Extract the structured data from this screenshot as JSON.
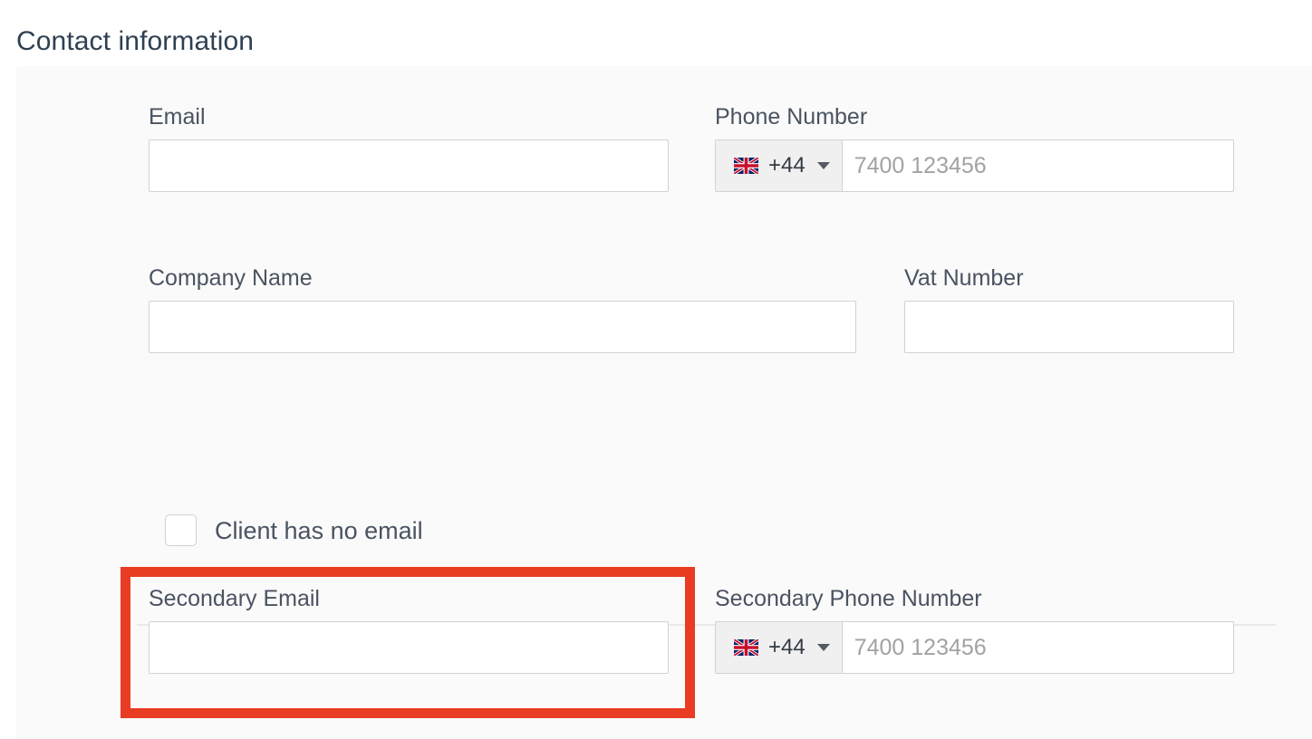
{
  "page": {
    "title": "Contact information"
  },
  "colors": {
    "title_text": "#2e4052",
    "label_text": "#4a5361",
    "panel_background": "#fafafa",
    "input_border": "#d2d2d2",
    "placeholder_text": "#9b9b9b",
    "highlight_annotation": "#e83c23",
    "divider": "#e9e9e9",
    "country_selector_background": "#f0f0f0"
  },
  "form": {
    "fields": {
      "email": {
        "label": "Email",
        "value": "",
        "placeholder": ""
      },
      "phone_number": {
        "label": "Phone Number",
        "country_flag_icon": "uk-flag-icon",
        "dial_code": "+44",
        "caret_icon": "chevron-down-icon",
        "value": "",
        "placeholder": "7400 123456"
      },
      "company_name": {
        "label": "Company Name",
        "value": "",
        "placeholder": ""
      },
      "vat_number": {
        "label": "Vat Number",
        "value": "",
        "placeholder": ""
      },
      "client_has_no_email": {
        "label": "Client has no email",
        "checked": false
      },
      "secondary_email": {
        "label": "Secondary Email",
        "value": "",
        "placeholder": "",
        "highlighted": true
      },
      "secondary_phone_number": {
        "label": "Secondary Phone Number",
        "country_flag_icon": "uk-flag-icon",
        "dial_code": "+44",
        "caret_icon": "chevron-down-icon",
        "value": "",
        "placeholder": "7400 123456"
      }
    }
  }
}
